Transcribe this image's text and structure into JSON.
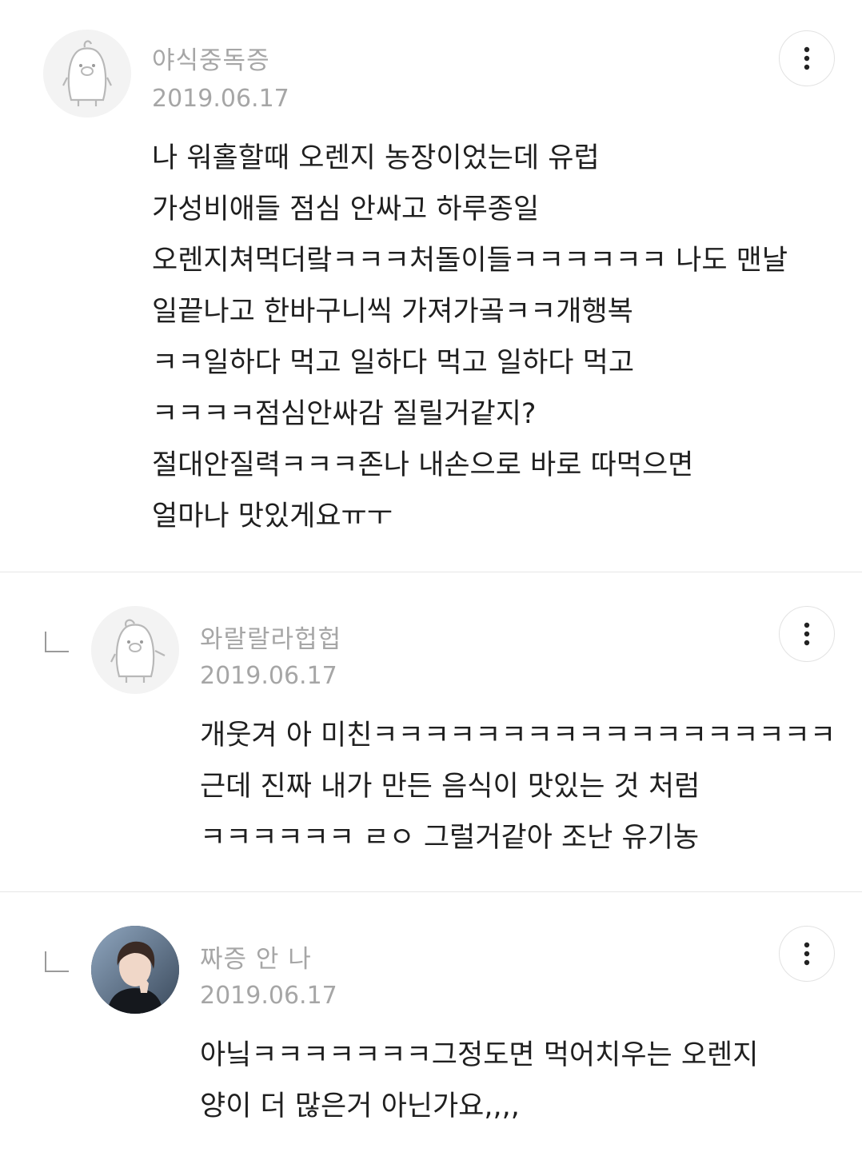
{
  "comments": [
    {
      "author": "야식중독증",
      "date": "2019.06.17",
      "is_reply": false,
      "avatar_icon": "penguin-default-icon",
      "lines": [
        "나 워홀할때 오렌지 농장이었는데 유럽",
        "가성비애들 점심 안싸고 하루종일",
        "오렌지쳐먹더랔ㅋㅋㅋ처돌이들ㅋㅋㅋㅋㅋㅋ 나도 맨날",
        "일끝나고 한바구니씩 가져가곸ㅋㅋ개행복",
        "ㅋㅋ일하다 먹고 일하다 먹고 일하다 먹고",
        "ㅋㅋㅋㅋ점심안싸감 질릴거같지?",
        "절대안질력ㅋㅋㅋ존나 내손으로 바로 따먹으면",
        "얼마나 맛있게요ㅠㅜ"
      ]
    },
    {
      "author": "와랄랄라헙헙",
      "date": "2019.06.17",
      "is_reply": true,
      "avatar_icon": "penguin-default-icon",
      "lines": [
        "개웃겨 아 미친ㅋㅋㅋㅋㅋㅋㅋㅋㅋㅋㅋㅋㅋㅋㅋㅋㅋㅋ",
        "근데 진짜 내가 만든 음식이 맛있는 것 처럼",
        "ㅋㅋㅋㅋㅋㅋ ㄹㅇ 그럴거같아 조난 유기농"
      ]
    },
    {
      "author": "짜증 안 나",
      "date": "2019.06.17",
      "is_reply": true,
      "avatar_icon": "user-photo-avatar",
      "lines": [
        "아닠ㅋㅋㅋㅋㅋㅋㅋ그정도면 먹어치우는 오렌지",
        "양이 더 많은거 아닌가요,,,,"
      ]
    }
  ],
  "icons": {
    "more": "more-vertical-icon",
    "reply": "reply-indent-icon"
  },
  "colors": {
    "meta_text": "#a6a6a6",
    "body_text": "#1f1f1f",
    "divider": "#e6e6e6"
  }
}
